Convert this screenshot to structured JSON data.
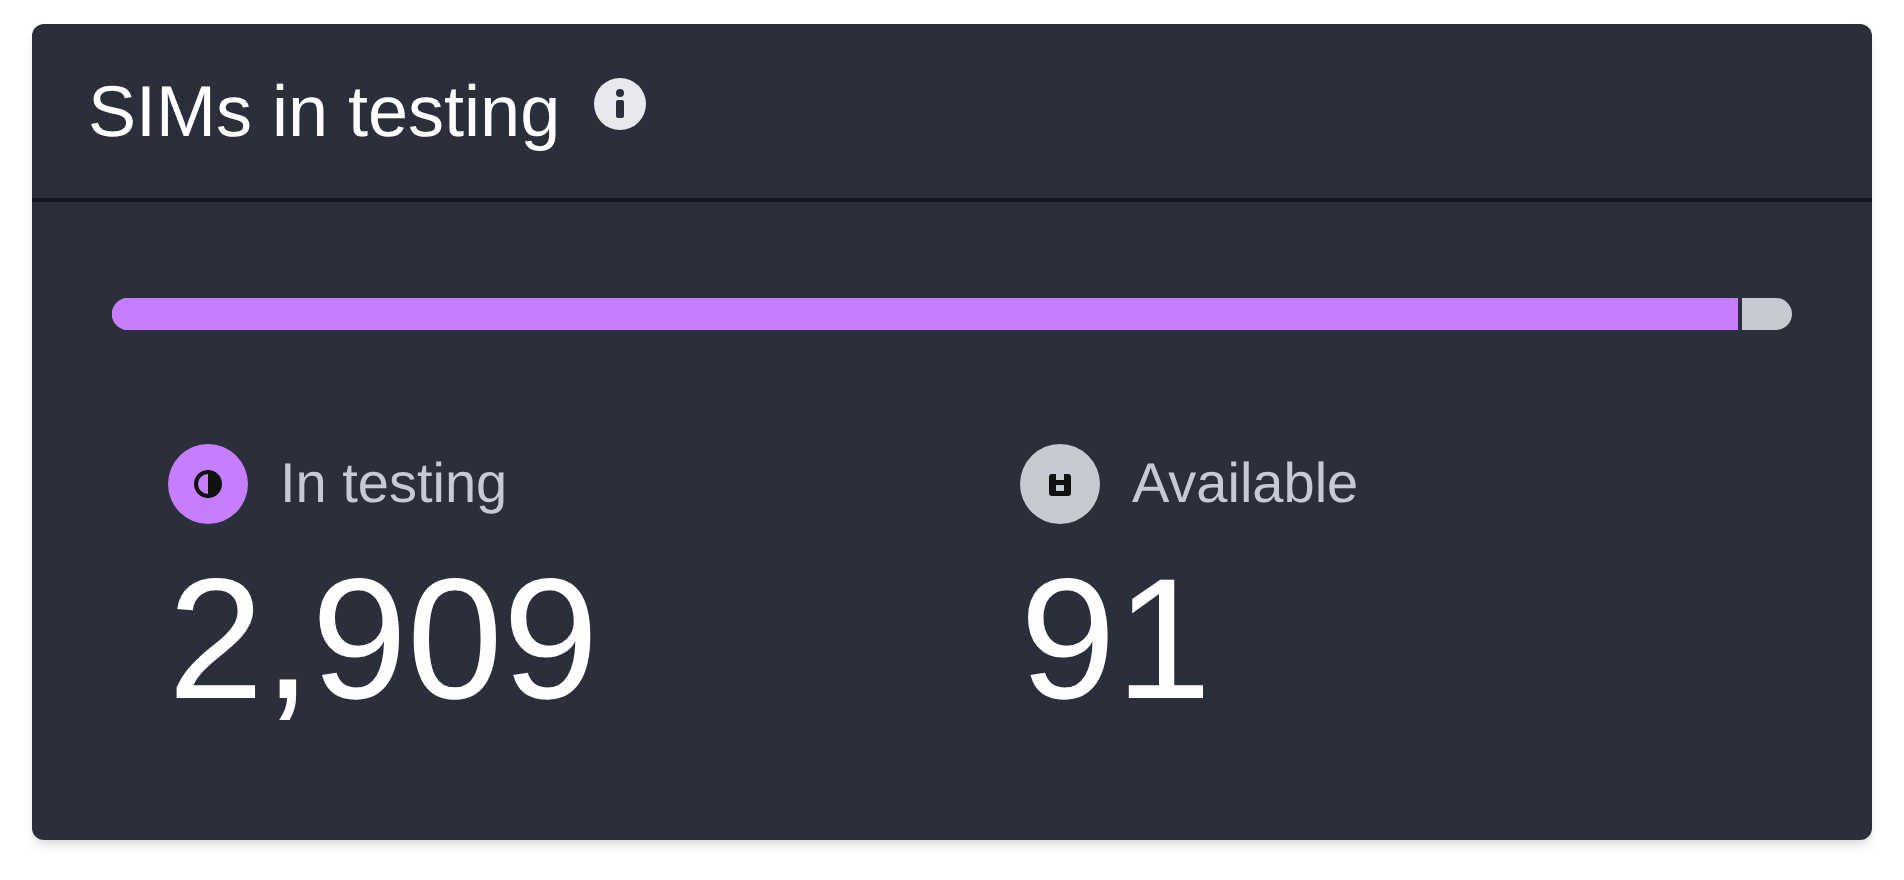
{
  "card": {
    "title": "SIMs in testing"
  },
  "bar": {
    "level": 0.9697
  },
  "stats": [
    {
      "kind": "testing",
      "label": "In testing",
      "value": "2,909",
      "color": "#c77dff"
    },
    {
      "kind": "available",
      "label": "Available",
      "value": "91",
      "color": "#c5cad3"
    }
  ]
}
